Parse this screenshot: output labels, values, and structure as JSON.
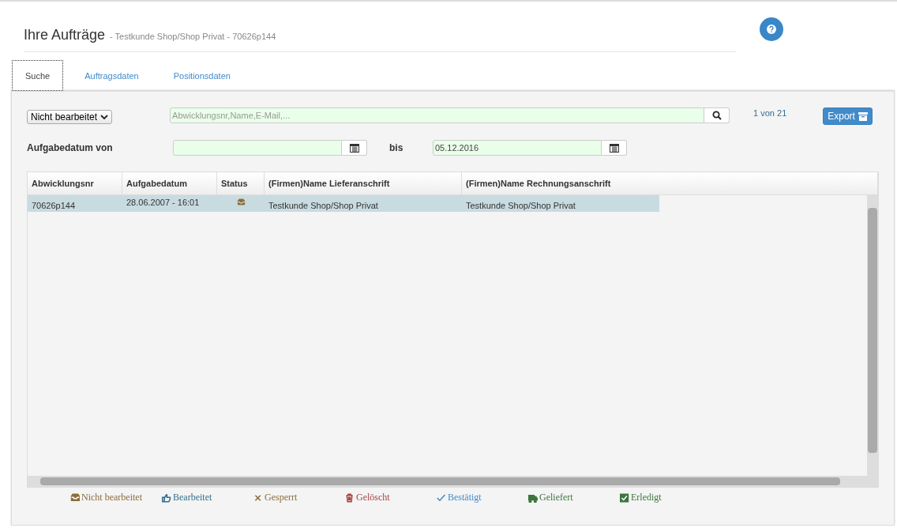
{
  "header": {
    "title": "Ihre Aufträge",
    "subtitle": "- Testkunde Shop/Shop Privat - 70626p144"
  },
  "tabs": [
    {
      "label": "Suche",
      "selected": true
    },
    {
      "label": "Auftragsdaten",
      "selected": false
    },
    {
      "label": "Positionsdaten",
      "selected": false
    }
  ],
  "filter": {
    "status_select": "Nicht bearbeitet",
    "search": {
      "placeholder": "Abwicklungsnr,Name,E-Mail,..."
    },
    "pagination": "1 von 21",
    "export_button": "Export"
  },
  "date_range": {
    "label": "Aufgabedatum von",
    "to_label": "bis",
    "to": {
      "value": "05.12.2016"
    }
  },
  "table": {
    "columns": [
      "Abwicklungsnr",
      "Aufgabedatum",
      "Status",
      "(Firmen)Name Lieferanschrift",
      "(Firmen)Name Rechnungsanschrift"
    ],
    "rows": [
      {
        "selected": true,
        "cells": [
          "70626p144",
          "28.06.2007 - 16:01",
          {
            "kind": "inbox"
          },
          "Testkunde Shop/Shop Privat",
          "Testkunde Shop/Shop Privat"
        ]
      }
    ]
  },
  "legend": [
    {
      "kind": "inbox",
      "label": "Nicht bearbeitet",
      "color": "#8a6d3b"
    },
    {
      "kind": "thumb",
      "label": "Bearbeitet",
      "color": "#31708f"
    },
    {
      "kind": "cross",
      "label": "Gesperrt",
      "color": "#8a6d3b"
    },
    {
      "kind": "trash",
      "label": "Gelöscht",
      "color": "#a94442"
    },
    {
      "kind": "check",
      "label": "Bestätigt",
      "color": "#428bca"
    },
    {
      "kind": "truck",
      "label": "Geliefert",
      "color": "#3c763d"
    },
    {
      "kind": "checkbox",
      "label": "Erledigt",
      "color": "#3c763d"
    }
  ]
}
